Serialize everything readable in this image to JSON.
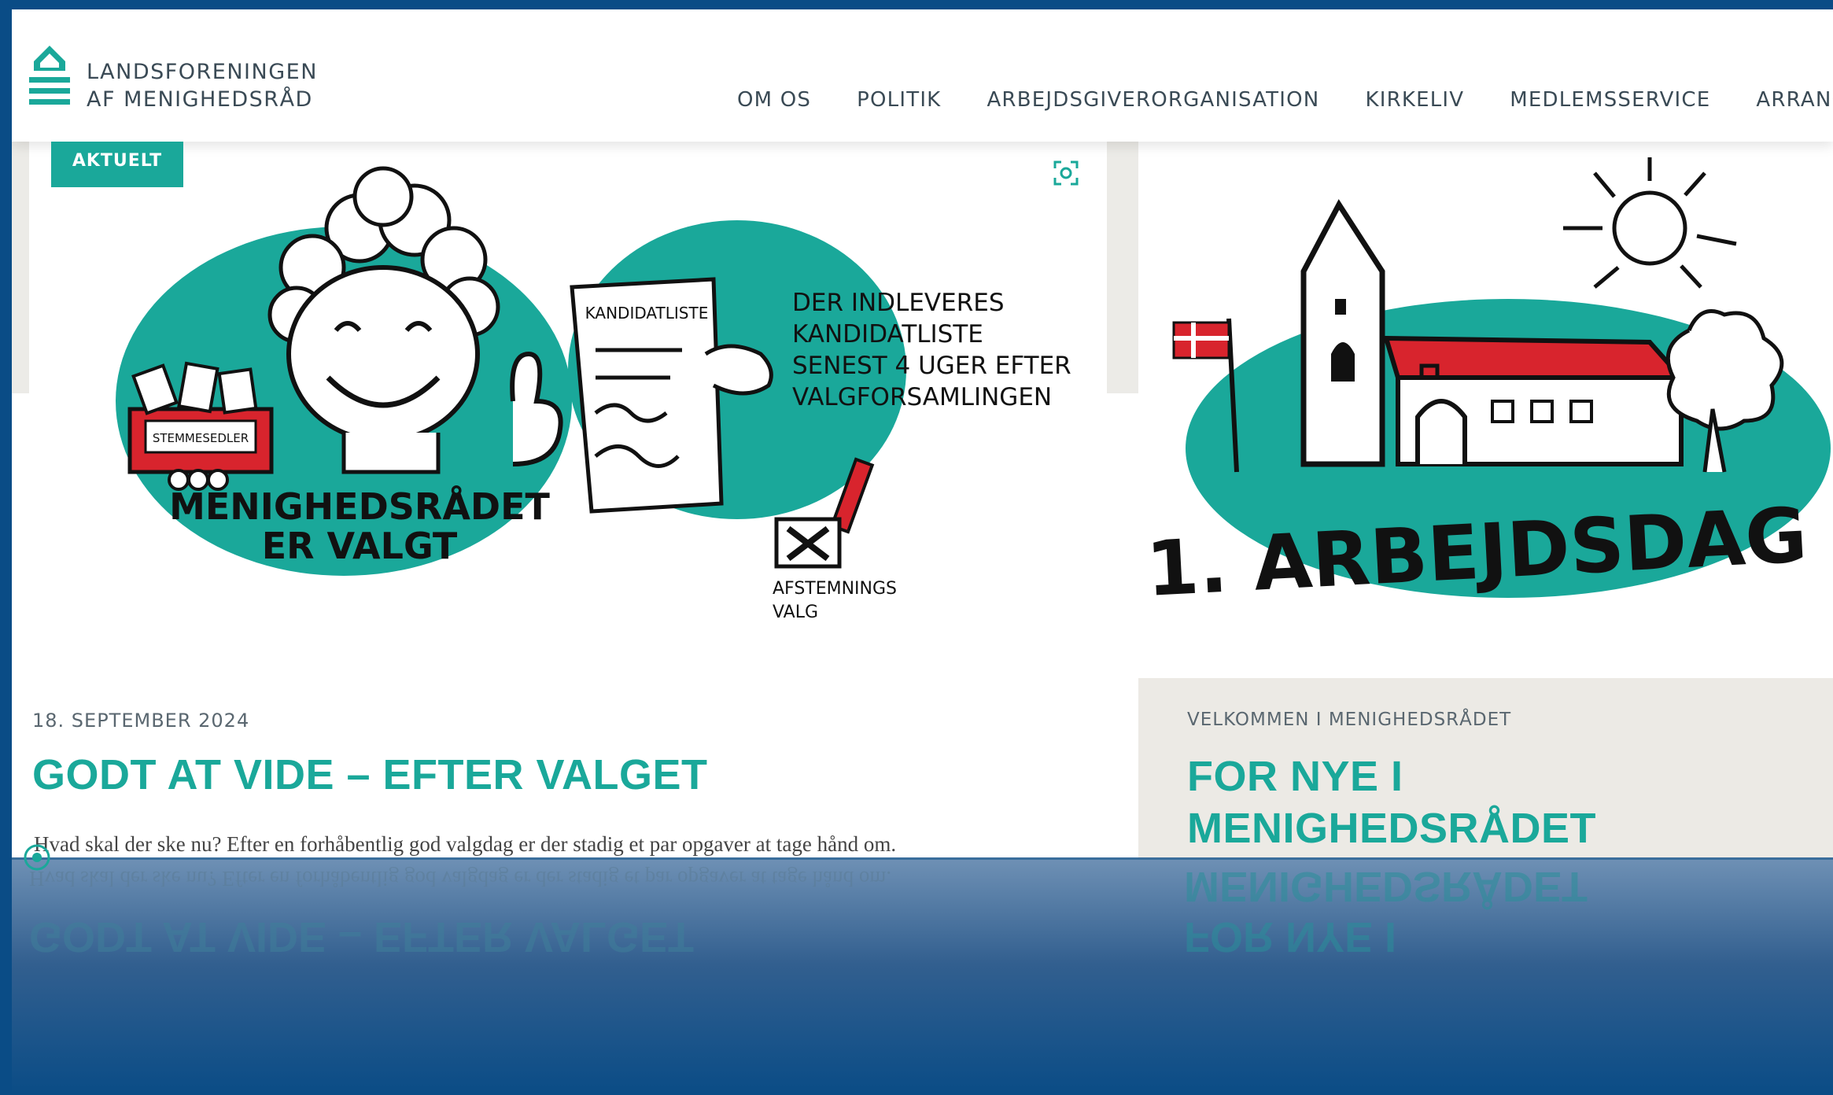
{
  "header": {
    "logo_line1": "LANDSFORENINGEN",
    "logo_line2": "AF MENIGHEDSRÅD",
    "nav": [
      "OM OS",
      "POLITIK",
      "ARBEJDSGIVERORGANISATION",
      "KIRKELIV",
      "MEDLEMSSERVICE",
      "ARRANGEMENTER"
    ]
  },
  "card1": {
    "badge": "AKTUELT",
    "illustration_text": {
      "ballot_box": "STEMMESEDLER",
      "caption_left1": "MENIGHEDSRÅDET",
      "caption_left2": "ER VALGT",
      "doc_title": "KANDIDATLISTE",
      "note1": "DER INDLEVERES",
      "note2": "KANDIDATLISTE",
      "note3": "SENEST 4 UGER EFTER",
      "note4": "VALGFORSAMLINGEN",
      "vote1": "AFSTEMNINGS",
      "vote2": "VALG"
    },
    "date": "18. SEPTEMBER 2024",
    "title": "GODT AT VIDE – EFTER VALGET",
    "teaser": "Hvad skal der ske nu? Efter en forhåbentlig god valgdag er der stadig et par opgaver at tage hånd om."
  },
  "card2": {
    "illustration_text": "1. ARBEJDSDAG",
    "kicker": "VELKOMMEN I MENIGHEDSRÅDET",
    "title_line1": "FOR NYE I",
    "title_line2": "MENIGHEDSRÅDET"
  },
  "colors": {
    "teal": "#1aa89a",
    "frame_blue": "#0a4c86",
    "red": "#d8242d",
    "text_grey": "#3a4a55"
  }
}
